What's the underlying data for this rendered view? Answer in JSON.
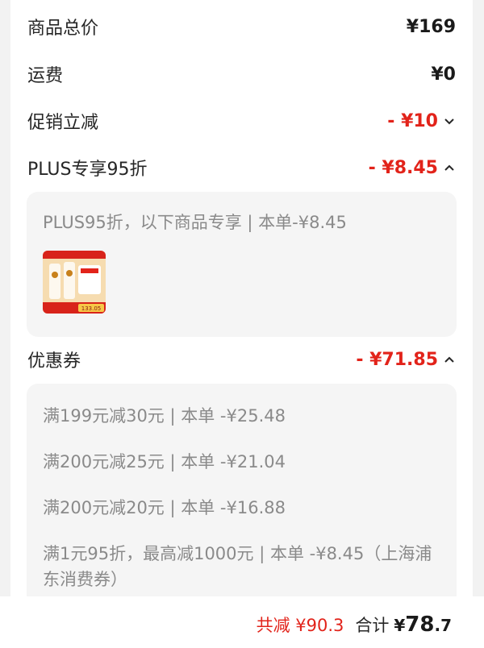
{
  "summary": {
    "items_total": {
      "label": "商品总价",
      "value": "¥169"
    },
    "shipping": {
      "label": "运费",
      "value": "¥0"
    },
    "promo": {
      "label": "促销立减",
      "value": "- ¥10"
    },
    "plus": {
      "label": "PLUS专享95折",
      "value": "- ¥8.45"
    }
  },
  "plus_panel": {
    "text": "PLUS95折，以下商品专享 | 本单-¥8.45",
    "thumb_badge": "133.05"
  },
  "coupons": {
    "label": "优惠券",
    "value": "- ¥71.85",
    "items": [
      "满199元减30元 | 本单 -¥25.48",
      "满200元减25元 | 本单 -¥21.04",
      "满200元减20元 | 本单 -¥16.88",
      "满1元95折，最高减1000元 | 本单 -¥8.45（上海浦东消费券）"
    ]
  },
  "footer": {
    "saved": "共减 ¥90.3",
    "total_label": "合计",
    "total_yen": "¥",
    "total_int": "78",
    "total_dec": ".7"
  },
  "colors": {
    "accent": "#e2231a",
    "panel_bg": "#f5f5f5",
    "page_bg": "#f2f2f2"
  }
}
